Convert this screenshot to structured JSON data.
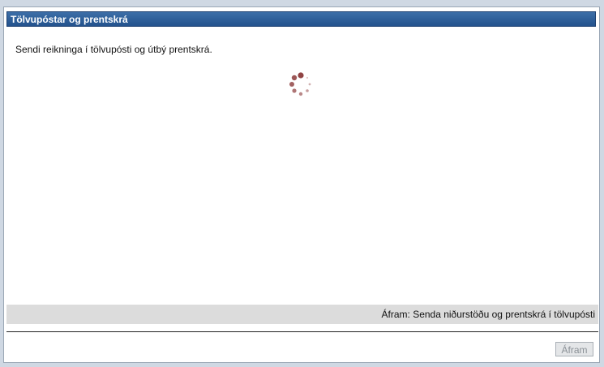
{
  "dialog": {
    "title": "Tölvupóstar og prentskrá",
    "message": "Sendi reikninga í tölvupósti og útbý prentskrá.",
    "spinner_icon": "loading-spinner-icon",
    "status_text": "Áfram: Senda niðurstöðu og prentskrá í tölvupósti",
    "next_button_label": "Áfram",
    "next_button_enabled": false
  },
  "colors": {
    "titlebar": "#2a5b97",
    "spinner": "#8b3a3a",
    "statusbar": "#dcdcdc"
  }
}
